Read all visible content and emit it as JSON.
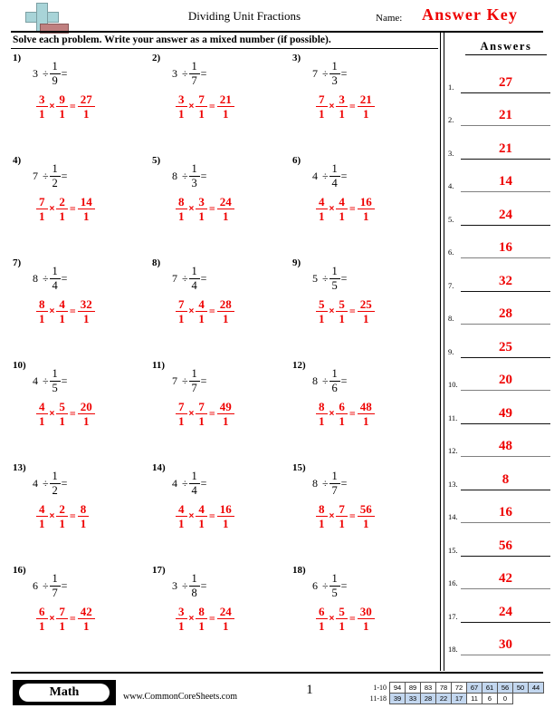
{
  "header": {
    "title": "Dividing Unit Fractions",
    "name_label": "Name:",
    "answer_key_label": "Answer Key",
    "logo_icon": "plus-book-icon"
  },
  "instructions": "Solve each problem. Write your answer as a mixed number (if possible).",
  "answers_panel": {
    "heading": "Answers",
    "items": [
      {
        "index": "1.",
        "value": "27"
      },
      {
        "index": "2.",
        "value": "21"
      },
      {
        "index": "3.",
        "value": "21"
      },
      {
        "index": "4.",
        "value": "14"
      },
      {
        "index": "5.",
        "value": "24"
      },
      {
        "index": "6.",
        "value": "16"
      },
      {
        "index": "7.",
        "value": "32"
      },
      {
        "index": "8.",
        "value": "28"
      },
      {
        "index": "9.",
        "value": "25"
      },
      {
        "index": "10.",
        "value": "20"
      },
      {
        "index": "11.",
        "value": "49"
      },
      {
        "index": "12.",
        "value": "48"
      },
      {
        "index": "13.",
        "value": "8"
      },
      {
        "index": "14.",
        "value": "16"
      },
      {
        "index": "15.",
        "value": "56"
      },
      {
        "index": "16.",
        "value": "42"
      },
      {
        "index": "17.",
        "value": "24"
      },
      {
        "index": "18.",
        "value": "30"
      }
    ]
  },
  "symbols": {
    "divide": "÷",
    "equals": "=",
    "times": "×"
  },
  "problems": [
    {
      "num": "1)",
      "whole": "3",
      "div_num": "1",
      "div_den": "9",
      "w1_num": "3",
      "w1_den": "1",
      "w2_num": "9",
      "w2_den": "1",
      "res_num": "27",
      "res_den": "1"
    },
    {
      "num": "2)",
      "whole": "3",
      "div_num": "1",
      "div_den": "7",
      "w1_num": "3",
      "w1_den": "1",
      "w2_num": "7",
      "w2_den": "1",
      "res_num": "21",
      "res_den": "1"
    },
    {
      "num": "3)",
      "whole": "7",
      "div_num": "1",
      "div_den": "3",
      "w1_num": "7",
      "w1_den": "1",
      "w2_num": "3",
      "w2_den": "1",
      "res_num": "21",
      "res_den": "1"
    },
    {
      "num": "4)",
      "whole": "7",
      "div_num": "1",
      "div_den": "2",
      "w1_num": "7",
      "w1_den": "1",
      "w2_num": "2",
      "w2_den": "1",
      "res_num": "14",
      "res_den": "1"
    },
    {
      "num": "5)",
      "whole": "8",
      "div_num": "1",
      "div_den": "3",
      "w1_num": "8",
      "w1_den": "1",
      "w2_num": "3",
      "w2_den": "1",
      "res_num": "24",
      "res_den": "1"
    },
    {
      "num": "6)",
      "whole": "4",
      "div_num": "1",
      "div_den": "4",
      "w1_num": "4",
      "w1_den": "1",
      "w2_num": "4",
      "w2_den": "1",
      "res_num": "16",
      "res_den": "1"
    },
    {
      "num": "7)",
      "whole": "8",
      "div_num": "1",
      "div_den": "4",
      "w1_num": "8",
      "w1_den": "1",
      "w2_num": "4",
      "w2_den": "1",
      "res_num": "32",
      "res_den": "1"
    },
    {
      "num": "8)",
      "whole": "7",
      "div_num": "1",
      "div_den": "4",
      "w1_num": "7",
      "w1_den": "1",
      "w2_num": "4",
      "w2_den": "1",
      "res_num": "28",
      "res_den": "1"
    },
    {
      "num": "9)",
      "whole": "5",
      "div_num": "1",
      "div_den": "5",
      "w1_num": "5",
      "w1_den": "1",
      "w2_num": "5",
      "w2_den": "1",
      "res_num": "25",
      "res_den": "1"
    },
    {
      "num": "10)",
      "whole": "4",
      "div_num": "1",
      "div_den": "5",
      "w1_num": "4",
      "w1_den": "1",
      "w2_num": "5",
      "w2_den": "1",
      "res_num": "20",
      "res_den": "1"
    },
    {
      "num": "11)",
      "whole": "7",
      "div_num": "1",
      "div_den": "7",
      "w1_num": "7",
      "w1_den": "1",
      "w2_num": "7",
      "w2_den": "1",
      "res_num": "49",
      "res_den": "1"
    },
    {
      "num": "12)",
      "whole": "8",
      "div_num": "1",
      "div_den": "6",
      "w1_num": "8",
      "w1_den": "1",
      "w2_num": "6",
      "w2_den": "1",
      "res_num": "48",
      "res_den": "1"
    },
    {
      "num": "13)",
      "whole": "4",
      "div_num": "1",
      "div_den": "2",
      "w1_num": "4",
      "w1_den": "1",
      "w2_num": "2",
      "w2_den": "1",
      "res_num": "8",
      "res_den": "1"
    },
    {
      "num": "14)",
      "whole": "4",
      "div_num": "1",
      "div_den": "4",
      "w1_num": "4",
      "w1_den": "1",
      "w2_num": "4",
      "w2_den": "1",
      "res_num": "16",
      "res_den": "1"
    },
    {
      "num": "15)",
      "whole": "8",
      "div_num": "1",
      "div_den": "7",
      "w1_num": "8",
      "w1_den": "1",
      "w2_num": "7",
      "w2_den": "1",
      "res_num": "56",
      "res_den": "1"
    },
    {
      "num": "16)",
      "whole": "6",
      "div_num": "1",
      "div_den": "7",
      "w1_num": "6",
      "w1_den": "1",
      "w2_num": "7",
      "w2_den": "1",
      "res_num": "42",
      "res_den": "1"
    },
    {
      "num": "17)",
      "whole": "3",
      "div_num": "1",
      "div_den": "8",
      "w1_num": "3",
      "w1_den": "1",
      "w2_num": "8",
      "w2_den": "1",
      "res_num": "24",
      "res_den": "1"
    },
    {
      "num": "18)",
      "whole": "6",
      "div_num": "1",
      "div_den": "5",
      "w1_num": "6",
      "w1_den": "1",
      "w2_num": "5",
      "w2_den": "1",
      "res_num": "30",
      "res_den": "1"
    }
  ],
  "footer": {
    "subject": "Math",
    "site_url": "www.CommonCoreSheets.com",
    "page_number": "1",
    "score_table": {
      "row1_label": "1-10",
      "row2_label": "11-18",
      "row1": [
        {
          "v": "94",
          "hl": false
        },
        {
          "v": "89",
          "hl": false
        },
        {
          "v": "83",
          "hl": false
        },
        {
          "v": "78",
          "hl": false
        },
        {
          "v": "72",
          "hl": false
        },
        {
          "v": "67",
          "hl": true
        },
        {
          "v": "61",
          "hl": true
        },
        {
          "v": "56",
          "hl": true
        },
        {
          "v": "50",
          "hl": true
        },
        {
          "v": "44",
          "hl": true
        }
      ],
      "row2": [
        {
          "v": "39",
          "hl": true
        },
        {
          "v": "33",
          "hl": true
        },
        {
          "v": "28",
          "hl": true
        },
        {
          "v": "22",
          "hl": true
        },
        {
          "v": "17",
          "hl": true
        },
        {
          "v": "11",
          "hl": false
        },
        {
          "v": "6",
          "hl": false
        },
        {
          "v": "0",
          "hl": false
        }
      ]
    }
  },
  "colors": {
    "answer_red": "#ee0000",
    "highlight_blue": "#c3d7ef",
    "logo_teal": "#a8d4d8",
    "logo_red": "#c08080"
  }
}
